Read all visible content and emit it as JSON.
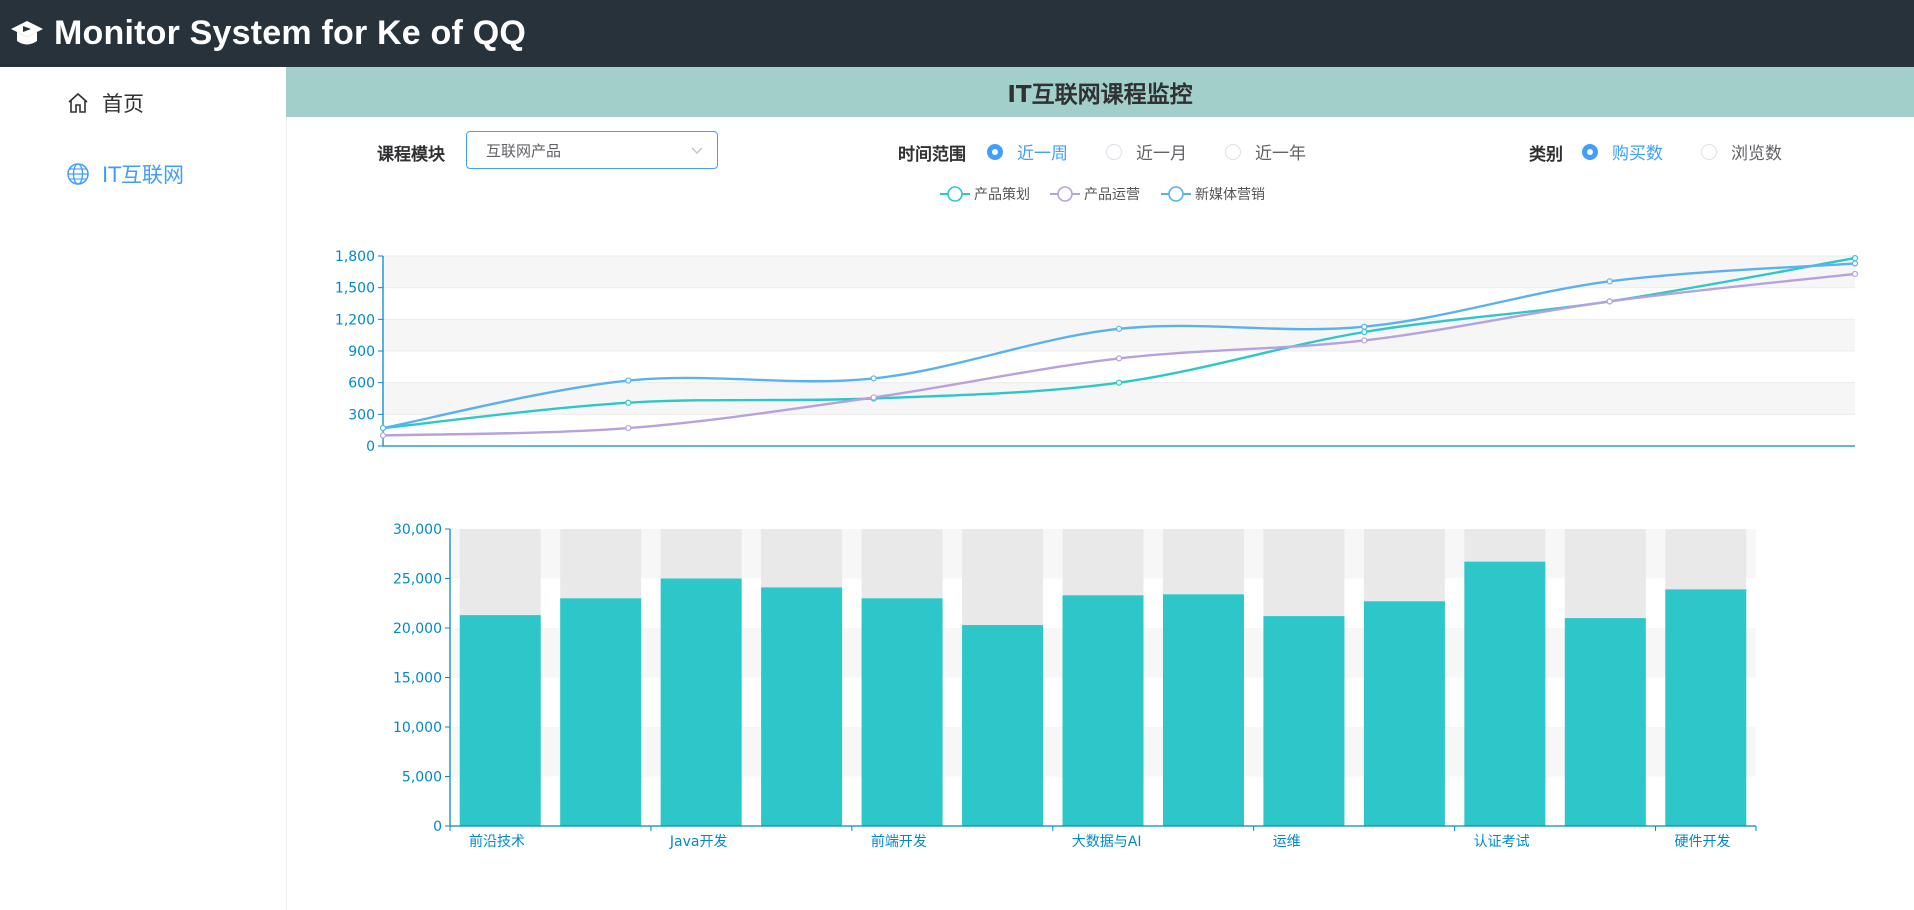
{
  "header": {
    "title": "Monitor System for Ke of QQ",
    "logo_icon": "graduation-cap-icon"
  },
  "sidebar": {
    "items": [
      {
        "label": "首页",
        "icon": "home-icon",
        "active": false
      },
      {
        "label": "IT互联网",
        "icon": "globe-icon",
        "active": true
      }
    ]
  },
  "page": {
    "title": "IT互联网课程监控"
  },
  "filters": {
    "module_label": "课程模块",
    "module_value": "互联网产品",
    "time_label": "时间范围",
    "time_options": [
      "近一周",
      "近一月",
      "近一年"
    ],
    "time_selected": "近一周",
    "type_label": "类别",
    "type_options": [
      "购买数",
      "浏览数"
    ],
    "type_selected": "购买数"
  },
  "colors": {
    "accent": "#409eff",
    "header_bg": "#27323a",
    "page_head_bg": "#a2cfca",
    "bar": "#2ec7c9"
  },
  "chart_data": [
    {
      "type": "line",
      "smooth": true,
      "x": [
        "",
        "",
        "",
        "",
        "",
        "",
        ""
      ],
      "legend_position": "top-center",
      "ylim": [
        0,
        1800
      ],
      "yticks": [
        0,
        300,
        600,
        900,
        1200,
        1500,
        1800
      ],
      "grid": true,
      "series": [
        {
          "name": "产品策划",
          "color": "#2ec7c9",
          "values": [
            170,
            410,
            450,
            600,
            1080,
            1370,
            1780
          ]
        },
        {
          "name": "产品运营",
          "color": "#b6a2de",
          "values": [
            100,
            170,
            460,
            830,
            1000,
            1370,
            1630
          ]
        },
        {
          "name": "新媒体营销",
          "color": "#5ab1ef",
          "values": [
            170,
            620,
            640,
            1110,
            1130,
            1560,
            1730
          ]
        }
      ]
    },
    {
      "type": "bar",
      "ylim": [
        0,
        30000
      ],
      "yticks": [
        0,
        5000,
        10000,
        15000,
        20000,
        25000,
        30000
      ],
      "ytick_labels": [
        "0",
        "5,000",
        "10,000",
        "15,000",
        "20,000",
        "25,000",
        "30,000"
      ],
      "grid": true,
      "categories": [
        "前沿技术",
        "",
        "Java开发",
        "",
        "前端开发",
        "",
        "大数据与AI",
        "",
        "运维",
        "",
        "认证考试",
        "",
        "硬件开发"
      ],
      "values": [
        21300,
        23000,
        25000,
        24100,
        23000,
        20300,
        23300,
        23400,
        21200,
        22700,
        26700,
        21000,
        23900
      ]
    }
  ]
}
